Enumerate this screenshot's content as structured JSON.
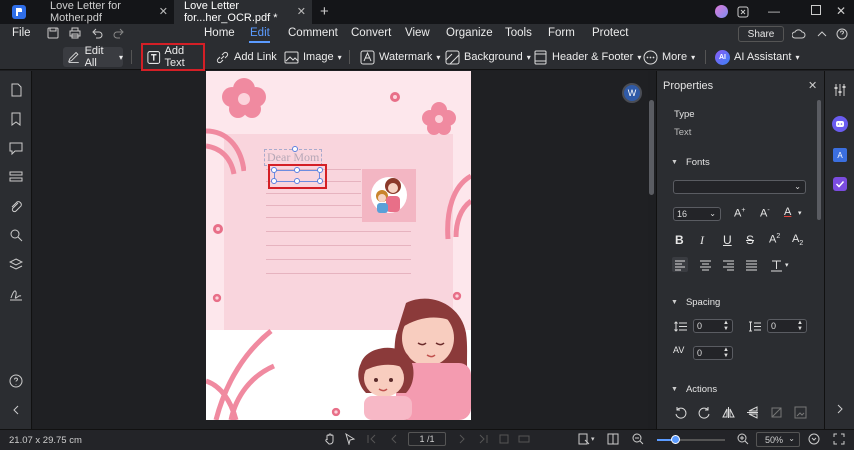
{
  "tabs": [
    {
      "label": "Love Letter for Mother.pdf"
    },
    {
      "label": "Love Letter for...her_OCR.pdf *"
    }
  ],
  "menu": {
    "file": "File",
    "items": [
      "Home",
      "Edit",
      "Comment",
      "Convert",
      "View",
      "Organize",
      "Tools",
      "Form",
      "Protect"
    ],
    "active": "Edit",
    "share": "Share"
  },
  "toolbar": {
    "edit_all": "Edit All",
    "add_text": "Add Text",
    "add_link": "Add Link",
    "image": "Image",
    "watermark": "Watermark",
    "background": "Background",
    "header_footer": "Header & Footer",
    "more": "More",
    "ai_assistant": "AI Assistant"
  },
  "document": {
    "dear_mom": "Dear Mom"
  },
  "properties": {
    "title": "Properties",
    "type_label": "Type",
    "type_value": "Text",
    "fonts_label": "Fonts",
    "font_family": "",
    "font_size": "16",
    "spacing_label": "Spacing",
    "line_spacing": "0",
    "paragraph_spacing": "0",
    "char_spacing": "0",
    "actions_label": "Actions"
  },
  "status": {
    "page_size": "21.07 x 29.75 cm",
    "page_number": "1 /1",
    "zoom": "50%",
    "zoom_fraction": 0.27
  },
  "colors": {
    "accent": "#5b9bff",
    "highlight_red": "#d41f26"
  }
}
